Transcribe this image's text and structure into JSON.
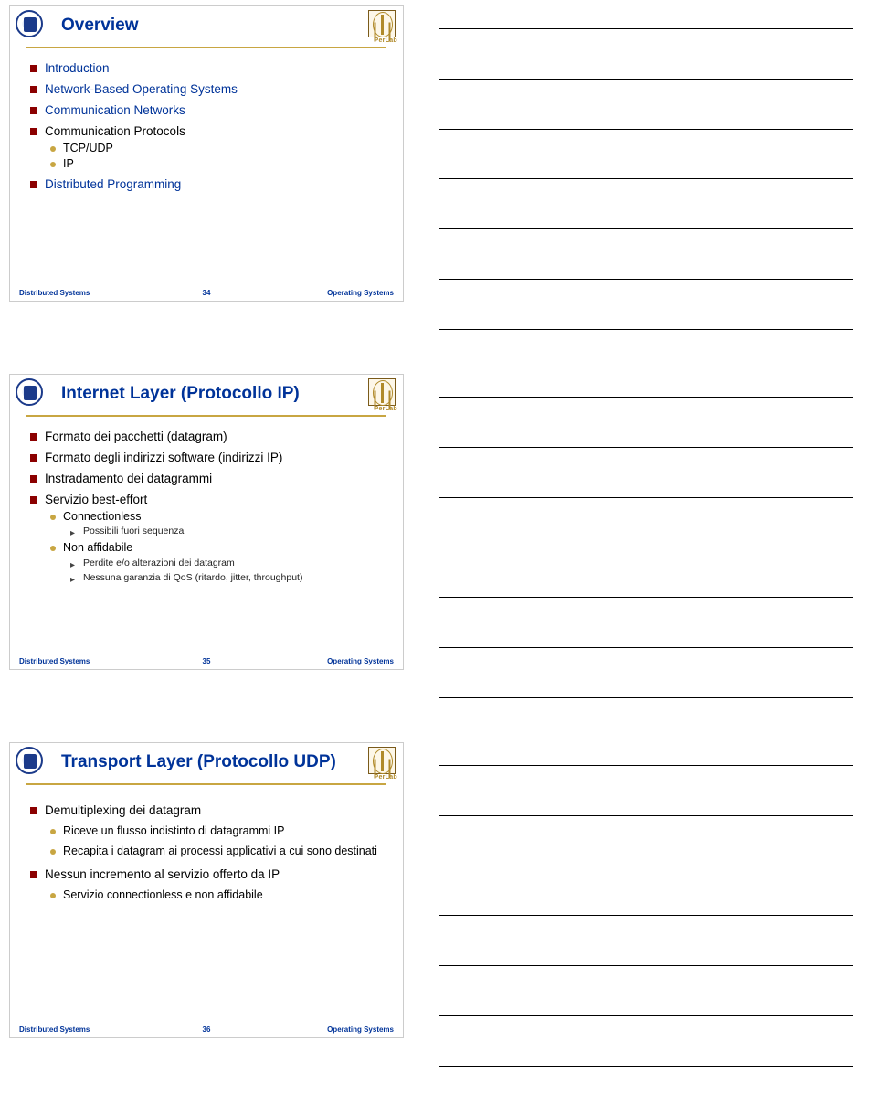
{
  "footer": {
    "left": "Distributed Systems",
    "right": "Operating Systems"
  },
  "perlab": "PerLab",
  "slides": [
    {
      "title": "Overview",
      "page": "34",
      "l1": [
        {
          "text": "Introduction",
          "blue": true
        },
        {
          "text": "Network-Based Operating Systems",
          "blue": true
        },
        {
          "text": "Communication Networks",
          "blue": true
        },
        {
          "text": "Communication Protocols",
          "blue": false,
          "l2": [
            {
              "text": "TCP/UDP"
            },
            {
              "text": "IP"
            }
          ]
        },
        {
          "text": "Distributed Programming",
          "blue": true
        }
      ]
    },
    {
      "title": "Internet Layer (Protocollo IP)",
      "page": "35",
      "l1": [
        {
          "text": "Formato dei pacchetti (datagram)"
        },
        {
          "text": "Formato degli indirizzi software (indirizzi IP)"
        },
        {
          "text": "Instradamento dei datagrammi"
        },
        {
          "text": "Servizio best-effort",
          "l2": [
            {
              "text": "Connectionless",
              "l3": [
                "Possibili fuori sequenza"
              ]
            },
            {
              "text": "Non affidabile",
              "l3": [
                "Perdite e/o alterazioni dei datagram",
                "Nessuna garanzia di QoS (ritardo, jitter, throughput)"
              ]
            }
          ]
        }
      ]
    },
    {
      "title": "Transport Layer (Protocollo UDP)",
      "page": "36",
      "l1": [
        {
          "text": "Demultiplexing dei datagram",
          "l2": [
            {
              "text": "Riceve un flusso indistinto di datagrammi IP"
            },
            {
              "text": "Recapita i datagram ai processi applicativi a cui sono destinati"
            }
          ]
        },
        {
          "text": "Nessun incremento al servizio offerto da IP",
          "l2": [
            {
              "text": "Servizio connectionless e non affidabile"
            }
          ]
        }
      ]
    }
  ]
}
